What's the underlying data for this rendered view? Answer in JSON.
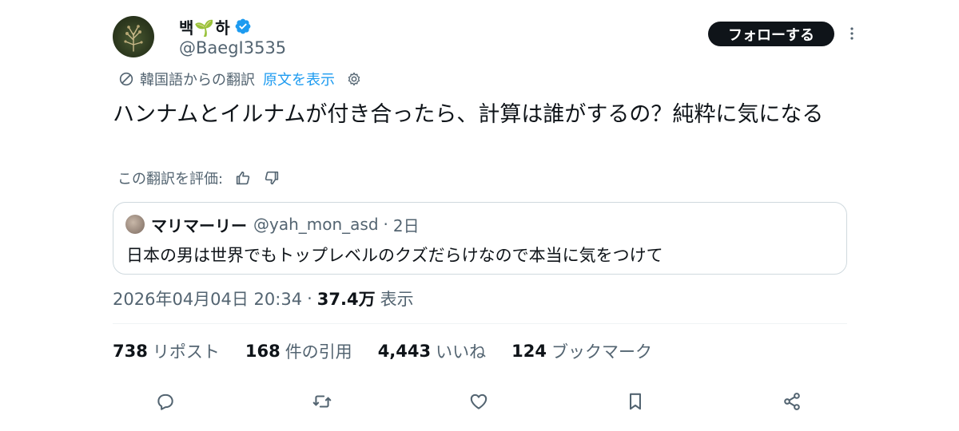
{
  "author": {
    "display_name": "백🌱하",
    "handle": "@BaegI3535",
    "verified": true,
    "avatar_icon": "plant-avatar"
  },
  "follow_button_label": "フォローする",
  "translation": {
    "translated_from": "韓国語からの翻訳",
    "show_original": "原文を表示"
  },
  "tweet_text": "ハンナムとイルナムが付き合ったら、計算は誰がするの？純粋に気になる",
  "rate_translation_label": "この翻訳を評価:",
  "quoted_tweet": {
    "display_name": "マリマーリー",
    "handle": "@yah_mon_asd",
    "separator": "·",
    "time": "2日",
    "text": "日本の男は世界でもトップレベルのクズだらけなので本当に気をつけて"
  },
  "meta": {
    "timestamp": "2026年04月04日 20:34",
    "separator": "·",
    "views_count": "37.4万",
    "views_label": "表示"
  },
  "stats": [
    {
      "count": "738",
      "label": "リポスト"
    },
    {
      "count": "168",
      "label": "件の引用"
    },
    {
      "count": "4,443",
      "label": "いいね"
    },
    {
      "count": "124",
      "label": "ブックマーク"
    }
  ],
  "actions": [
    "reply-icon",
    "repost-icon",
    "like-icon",
    "bookmark-icon",
    "share-icon"
  ],
  "colors": {
    "text_primary": "#0f1419",
    "text_secondary": "#536471",
    "link_blue": "#1d9bf0",
    "verified_blue": "#1d9bf0",
    "border": "#cfd9de"
  }
}
